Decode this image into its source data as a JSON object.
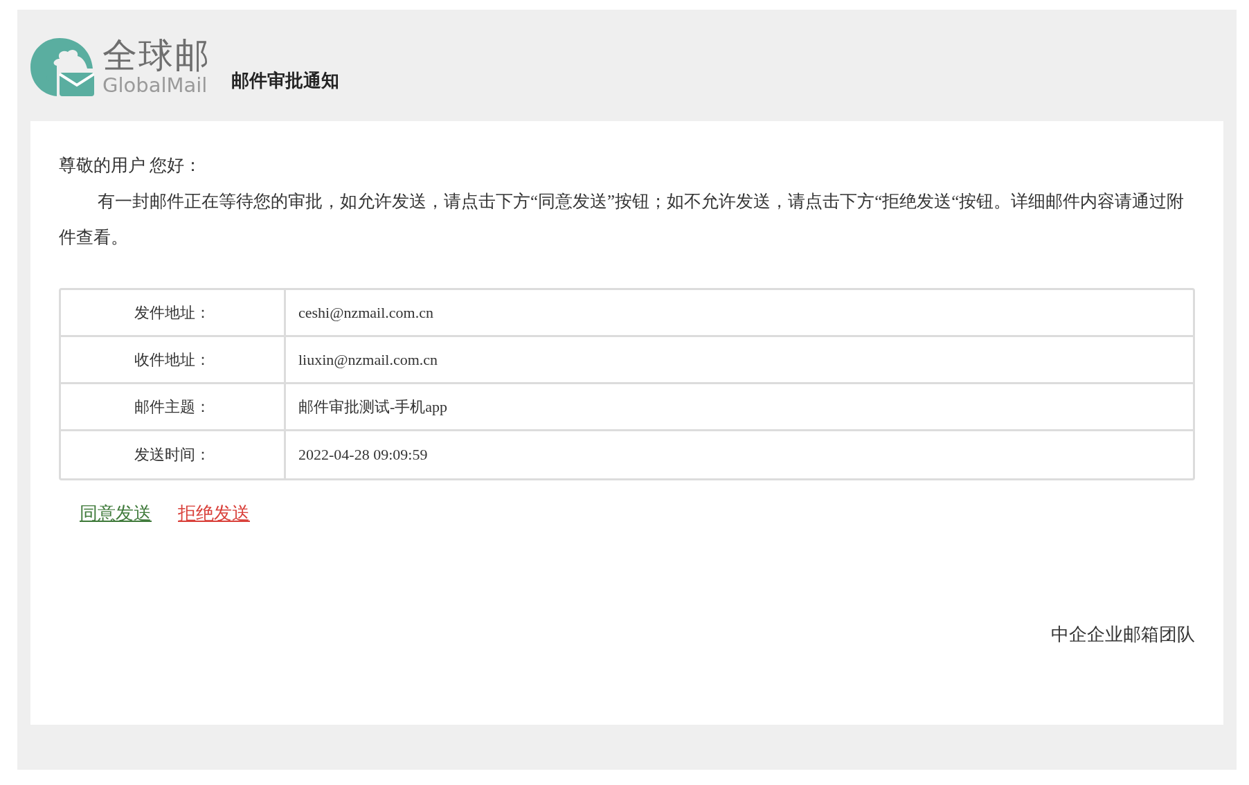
{
  "header": {
    "logo_name": "全球邮",
    "logo_subtitle": "GlobalMail",
    "title": "邮件审批通知"
  },
  "greeting": "尊敬的用户 您好：",
  "message": "有一封邮件正在等待您的审批，如允许发送，请点击下方“同意发送”按钮；如不允许发送，请点击下方“拒绝发送“按钮。详细邮件内容请通过附件查看。",
  "details": [
    {
      "label": "发件地址：",
      "value": "ceshi@nzmail.com.cn"
    },
    {
      "label": "收件地址：",
      "value": "liuxin@nzmail.com.cn"
    },
    {
      "label": "邮件主题：",
      "value": "邮件审批测试-手机app"
    },
    {
      "label": "发送时间：",
      "value": "2022-04-28 09:09:59"
    }
  ],
  "actions": [
    {
      "label": "同意发送",
      "color": "#3f7a3a"
    },
    {
      "label": "拒绝发送",
      "color": "#d9403a"
    }
  ],
  "signature": "中企企业邮箱团队"
}
